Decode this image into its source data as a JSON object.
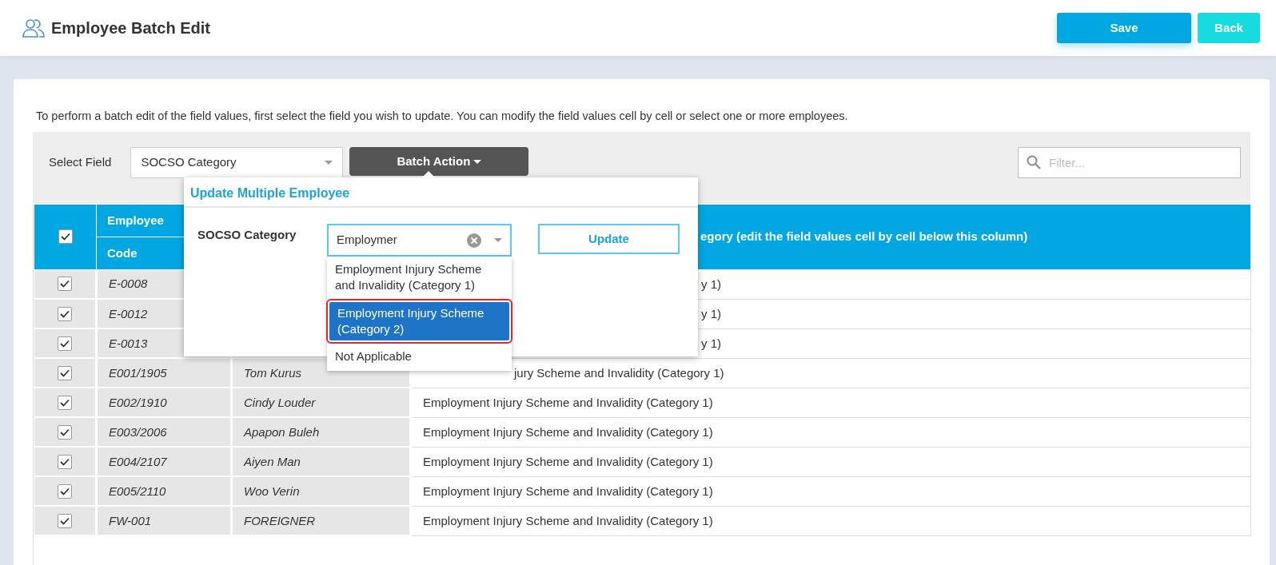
{
  "header": {
    "title": "Employee Batch Edit",
    "buttons": [
      {
        "label": "Save",
        "kind": "primary"
      },
      {
        "label": "Back",
        "kind": "secondary"
      }
    ]
  },
  "instructions": "To perform a batch edit of the field values, first select the field you wish to update. You can modify the field values cell by cell or select one or more employees.",
  "toolbar": {
    "field_label": "Select Field",
    "field_value": "SOCSO Category",
    "batch_button": "Batch Action",
    "filter": {
      "placeholder": "Filter..."
    }
  },
  "table": {
    "select_all_checked": true,
    "group_label": "Employee",
    "code_label": "Code",
    "value_label": "egory (edit the field values cell by cell below this column)",
    "rows": [
      {
        "checked": true,
        "code": "E-0008",
        "kind": "behind_popup",
        "value": "y 1)"
      },
      {
        "checked": true,
        "code": "E-0012",
        "kind": "behind_popup",
        "value": "y 1)"
      },
      {
        "checked": true,
        "code": "E-0013",
        "kind": "behind_popup",
        "value": "y 1)"
      },
      {
        "checked": true,
        "code": "E001/1905",
        "name": "Tom Kurus",
        "kind": "behind_list",
        "value": "jury Scheme and Invalidity (Category 1)"
      },
      {
        "checked": true,
        "code": "E002/1910",
        "name": "Cindy Louder",
        "kind": "full",
        "value": "Employment Injury Scheme and Invalidity (Category 1)"
      },
      {
        "checked": true,
        "code": "E003/2006",
        "name": "Apapon Buleh",
        "kind": "full",
        "value": "Employment Injury Scheme and Invalidity (Category 1)"
      },
      {
        "checked": true,
        "code": "E004/2107",
        "name": "Aiyen Man",
        "kind": "full",
        "value": "Employment Injury Scheme and Invalidity (Category 1)"
      },
      {
        "checked": true,
        "code": "E005/2110",
        "name": "Woo Verin",
        "kind": "full",
        "value": "Employment Injury Scheme and Invalidity (Category 1)"
      },
      {
        "checked": true,
        "code": "FW-001",
        "name": "FOREIGNER",
        "kind": "full",
        "value": "Employment Injury Scheme and Invalidity (Category 1)"
      }
    ]
  },
  "popup": {
    "title": "Update Multiple Employee",
    "field_label": "SOCSO Category",
    "input_value": "Employmer",
    "update_button": "Update",
    "options": [
      {
        "label": "Employment Injury Scheme and Invalidity (Category 1)",
        "selected": false
      },
      {
        "label": "Employment Injury Scheme (Category 2)",
        "selected": true
      },
      {
        "label": "Not Applicable",
        "selected": false
      }
    ]
  }
}
